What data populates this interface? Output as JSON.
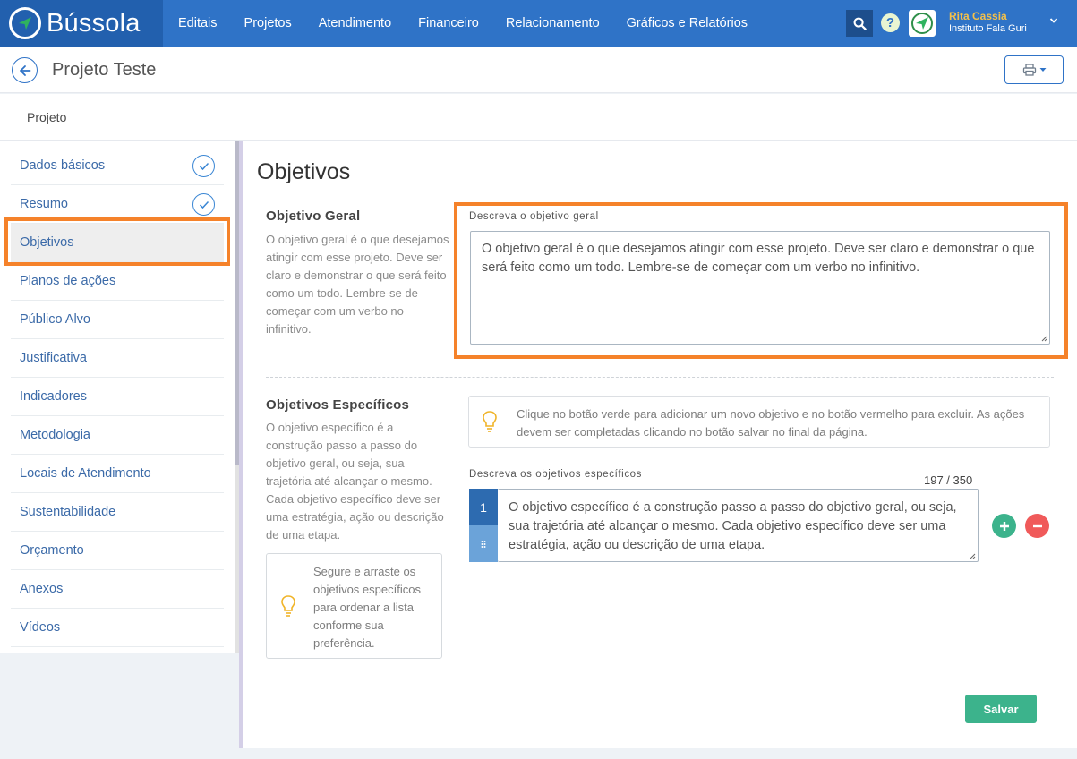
{
  "app": {
    "name": "Bússola"
  },
  "nav": {
    "items": [
      "Editais",
      "Projetos",
      "Atendimento",
      "Financeiro",
      "Relacionamento",
      "Gráficos e Relatórios"
    ]
  },
  "user": {
    "name": "Rita Cassia",
    "organization": "Instituto Fala Guri"
  },
  "header": {
    "title": "Projeto Teste"
  },
  "breadcrumb": {
    "label": "Projeto"
  },
  "sidebar": {
    "items": [
      {
        "label": "Dados básicos",
        "done": true
      },
      {
        "label": "Resumo",
        "done": true
      },
      {
        "label": "Objetivos",
        "active": true
      },
      {
        "label": "Planos de ações"
      },
      {
        "label": "Público Alvo"
      },
      {
        "label": "Justificativa"
      },
      {
        "label": "Indicadores"
      },
      {
        "label": "Metodologia"
      },
      {
        "label": "Locais de Atendimento"
      },
      {
        "label": "Sustentabilidade"
      },
      {
        "label": "Orçamento"
      },
      {
        "label": "Anexos"
      },
      {
        "label": "Vídeos"
      }
    ]
  },
  "main": {
    "title": "Objetivos",
    "general": {
      "title": "Objetivo Geral",
      "description": "O objetivo geral é o que desejamos atingir com esse projeto. Deve ser claro e demonstrar o que será feito como um todo. Lembre-se de começar com um verbo no infinitivo.",
      "field_label": "Descreva o objetivo geral",
      "value": "O objetivo geral é o que desejamos atingir com esse projeto. Deve ser claro e demonstrar o que será feito como um todo. Lembre-se de começar com um verbo no infinitivo."
    },
    "specific": {
      "title": "Objetivos Específicos",
      "description": "O objetivo específico é a construção passo a passo do objetivo geral, ou seja, sua trajetória até alcançar o mesmo. Cada objetivo específico deve ser uma estratégia, ação ou descrição de uma etapa.",
      "info": "Clique no botão verde para adicionar um novo objetivo e no botão vermelho para excluir. As ações devem ser completadas clicando no botão salvar no final da página.",
      "field_label": "Descreva os objetivos específicos",
      "counter": "197 / 350",
      "items": [
        {
          "number": "1",
          "value": "O objetivo específico é a construção passo a passo do objetivo geral, ou seja, sua trajetória até alcançar o mesmo. Cada objetivo específico deve ser uma estratégia, ação ou descrição de uma etapa."
        }
      ],
      "drag_hint": "Segure e arraste os objetivos específicos para ordenar a lista conforme sua preferência."
    },
    "save_label": "Salvar"
  },
  "colors": {
    "nav_bg": "#2f73c7",
    "logo_bg": "#2260ae",
    "highlight": "#f5822a",
    "save": "#3cb38c",
    "add": "#3cb38c",
    "remove": "#f05a5a"
  }
}
